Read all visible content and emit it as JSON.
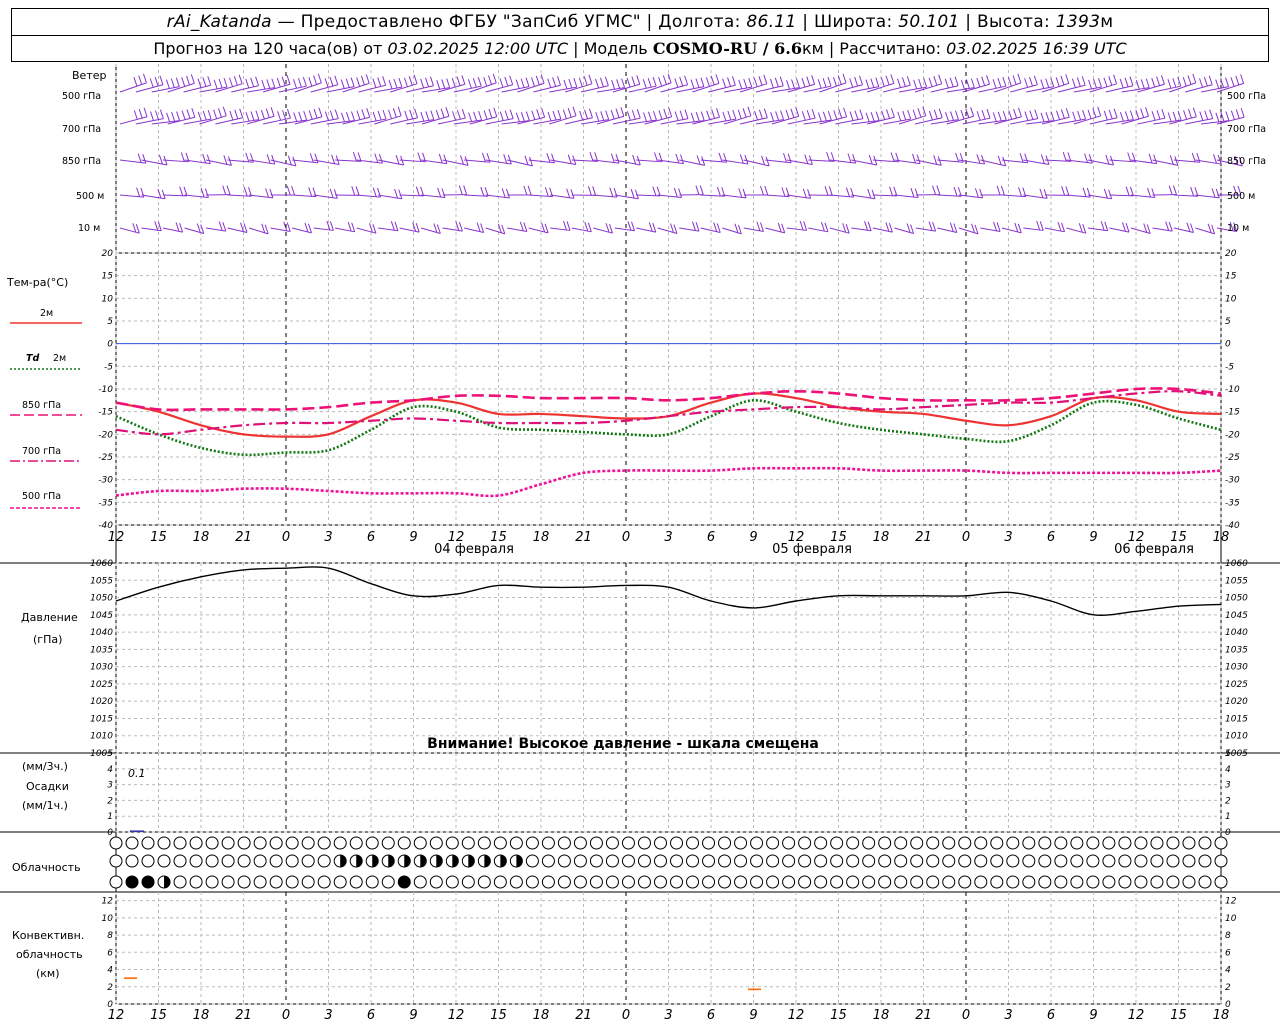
{
  "header": {
    "station": "rAi_Katanda",
    "provider": "— Предоставлено ФГБУ \"ЗапСиб УГМС\" | Долгота:",
    "lon": "86.11",
    "lat_label": "| Широта:",
    "lat": "50.101",
    "alt_label": "| Высота:",
    "alt": "1393",
    "alt_unit": "м",
    "forecast_label": "Прогноз на 120 часа(ов) от",
    "forecast_time": "03.02.2025 12:00 UTC",
    "model_label": "| Модель",
    "model": "COSMO-RU / 6.6",
    "model_unit": "км",
    "calc_label": "| Рассчитано:",
    "calc_time": "03.02.2025 16:39 UTC"
  },
  "labels": {
    "wind": "Ветер",
    "lvl500": "500 гПа",
    "lvl700": "700 гПа",
    "lvl850": "850 гПа",
    "lvl500m": "500 м",
    "lvl10m": "10  м",
    "temp_title": "Тем-ра(°С)",
    "leg_2m": "2м",
    "leg_td_sym": "Td",
    "leg_td": "2м",
    "leg_850": "850 гПа",
    "leg_700": "700 гПа",
    "leg_500": "500 гПа",
    "pressure_title": "Давление",
    "pressure_unit": "(гПа)",
    "warning": "Внимание! Высокое давление - шкала смещена",
    "precip_3h": "(мм/3ч.)",
    "precip_title": "Осадки",
    "precip_1h": "(мм/1ч.)",
    "precip_value": "0.1",
    "cloud_title": "Облачность",
    "conv_title1": "Конвективн.",
    "conv_title2": "облачность",
    "conv_unit": "(км)",
    "date1": "04 февраля",
    "date2": "05 февраля",
    "date3": "06 февраля"
  },
  "colors": {
    "t2m": "#ee3333",
    "td2m": "#117711",
    "t850": "#ee1177",
    "t700": "#dd1177",
    "t500": "#ee1199",
    "wind": "#8833cc",
    "pressure": "#000000",
    "convective": "#ff6600",
    "zero_line": "#3355dd"
  },
  "chart_data": [
    {
      "type": "line",
      "panel": "temperature",
      "x_ticks": [
        "12",
        "15",
        "18",
        "21",
        "0",
        "3",
        "6",
        "9",
        "12",
        "15",
        "18",
        "21",
        "0",
        "3",
        "6",
        "9",
        "12",
        "15",
        "18",
        "21",
        "0",
        "3",
        "6",
        "9",
        "12",
        "15",
        "18"
      ],
      "ylim": [
        -40,
        20
      ],
      "yticks": [
        20,
        15,
        10,
        5,
        0,
        -5,
        -10,
        -15,
        -20,
        -25,
        -30,
        -35,
        -40
      ],
      "series": [
        {
          "name": "2м",
          "style": "solid",
          "values": [
            -13,
            -15,
            -18,
            -20,
            -20.5,
            -20,
            -16,
            -12.5,
            -13,
            -15.5,
            -15.5,
            -16,
            -16.5,
            -16,
            -13,
            -11,
            -12,
            -14,
            -15,
            -15.5,
            -17,
            -18,
            -16,
            -12,
            -12.5,
            -15,
            -15.5
          ]
        },
        {
          "name": "Td 2м",
          "style": "dot",
          "values": [
            -16,
            -20,
            -23,
            -24.5,
            -24,
            -23.5,
            -19,
            -14,
            -15,
            -18.5,
            -19,
            -19.5,
            -20,
            -20,
            -16,
            -12.5,
            -15,
            -17.5,
            -19,
            -20,
            -21,
            -21.5,
            -18,
            -13,
            -13.5,
            -16.5,
            -19
          ]
        },
        {
          "name": "850 гПа",
          "style": "dash",
          "values": [
            -13,
            -14.5,
            -14.5,
            -14.5,
            -14.5,
            -14,
            -13,
            -12.5,
            -11.5,
            -11.5,
            -12,
            -12,
            -12,
            -12.5,
            -12,
            -11,
            -10.5,
            -11,
            -12,
            -12.5,
            -12.5,
            -12.5,
            -12,
            -11,
            -10,
            -10,
            -11
          ]
        },
        {
          "name": "700 гПа",
          "style": "dashdot",
          "values": [
            -19,
            -20,
            -19,
            -18,
            -17.5,
            -17.5,
            -17,
            -16.5,
            -17,
            -17.5,
            -17.5,
            -17.5,
            -17,
            -16,
            -15,
            -14.5,
            -14,
            -14,
            -14.5,
            -14,
            -13.5,
            -13,
            -13,
            -12,
            -11,
            -10.5,
            -11.5
          ]
        },
        {
          "name": "500 гПа",
          "style": "fine",
          "values": [
            -33.5,
            -32.5,
            -32.5,
            -32,
            -32,
            -32.5,
            -33,
            -33,
            -33,
            -33.5,
            -31,
            -28.5,
            -28,
            -28,
            -28,
            -27.5,
            -27.5,
            -27.5,
            -28,
            -28,
            -28,
            -28.5,
            -28.5,
            -28.5,
            -28.5,
            -28.5,
            -28
          ]
        }
      ]
    },
    {
      "type": "line",
      "panel": "pressure",
      "ylim": [
        1005,
        1060
      ],
      "yticks": [
        1060,
        1055,
        1050,
        1045,
        1040,
        1035,
        1030,
        1025,
        1020,
        1015,
        1010,
        1005
      ],
      "series": [
        {
          "name": "",
          "values": [
            1049,
            1053,
            1056,
            1058,
            1058.5,
            1058.5,
            1054,
            1050.5,
            1051,
            1053.5,
            1053,
            1053,
            1053.5,
            1053,
            1049,
            1047,
            1049,
            1050.5,
            1050.5,
            1050.5,
            1050.5,
            1051.5,
            1049,
            1045,
            1046,
            1047.5,
            1048
          ]
        }
      ]
    },
    {
      "type": "bar",
      "panel": "precipitation",
      "ylim": [
        0,
        5
      ],
      "yticks": [
        5,
        4,
        3,
        2,
        1,
        0
      ],
      "values": [
        0.1
      ]
    },
    {
      "type": "bar",
      "panel": "convective_cloud",
      "ylim": [
        0,
        13
      ],
      "yticks": [
        12,
        10,
        8,
        6,
        4,
        2,
        0
      ],
      "values": [
        3,
        1.7
      ]
    }
  ]
}
